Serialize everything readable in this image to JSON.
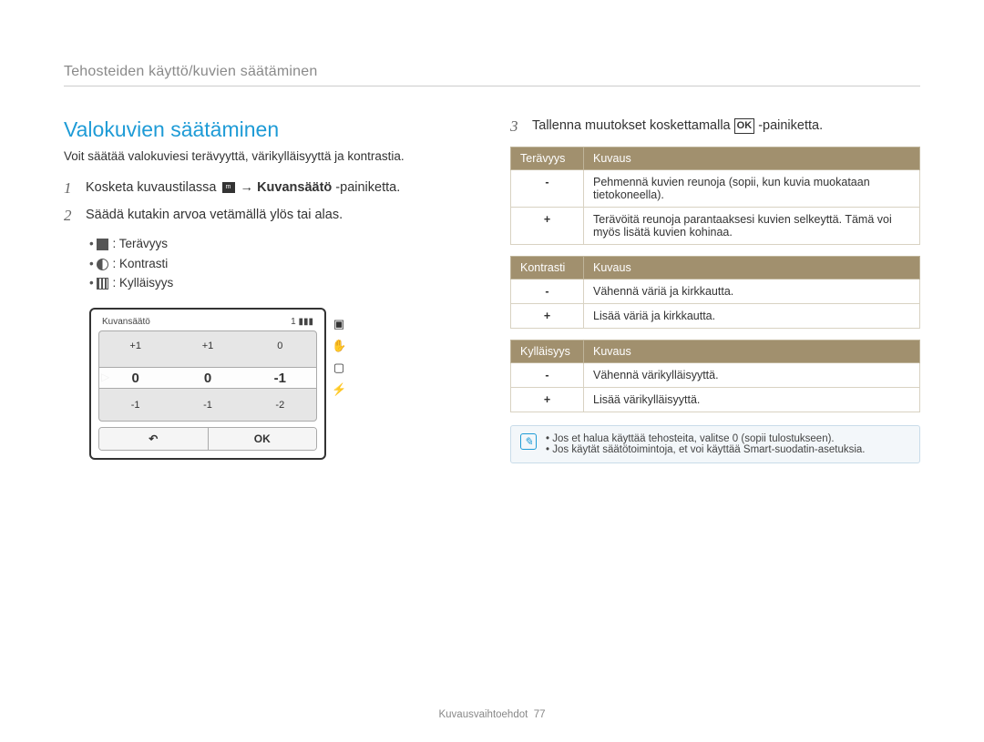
{
  "header": {
    "breadcrumb": "Tehosteiden käyttö/kuvien säätäminen"
  },
  "sectionTitle": "Valokuvien säätäminen",
  "intro": "Voit säätää valokuviesi terävyyttä, värikylläisyyttä ja kontrastia.",
  "steps": {
    "s1_prefix": "Kosketa kuvaustilassa ",
    "s1_menu": "m",
    "s1_arrow": " → ",
    "s1_bold": "Kuvansäätö",
    "s1_suffix": "-painiketta.",
    "s2": "Säädä kutakin arvoa vetämällä ylös tai alas.",
    "s3_prefix": "Tallenna muutokset koskettamalla ",
    "s3_icon": "OK",
    "s3_suffix": "-painiketta."
  },
  "bullets": {
    "b1": "Terävyys",
    "b2": "Kontrasti",
    "b3": "Kylläisyys"
  },
  "device": {
    "title": "Kuvansäätö",
    "counter": "1",
    "rowTop": {
      "c1": "+1",
      "c2": "+1",
      "c3": "0"
    },
    "rowMid": {
      "c1": "0",
      "c2": "0",
      "c3": "-1"
    },
    "rowBot": {
      "c1": "-1",
      "c2": "-1",
      "c3": "-2"
    },
    "back": "↶",
    "ok": "OK"
  },
  "tables": {
    "t1": {
      "h1": "Terävyys",
      "h2": "Kuvaus",
      "r1": {
        "k": "-",
        "v": "Pehmennä kuvien reunoja (sopii, kun kuvia muokataan tietokoneella)."
      },
      "r2": {
        "k": "+",
        "v": "Terävöitä reunoja parantaaksesi kuvien selkeyttä. Tämä voi myös lisätä kuvien kohinaa."
      }
    },
    "t2": {
      "h1": "Kontrasti",
      "h2": "Kuvaus",
      "r1": {
        "k": "-",
        "v": "Vähennä väriä ja kirkkautta."
      },
      "r2": {
        "k": "+",
        "v": "Lisää väriä ja kirkkautta."
      }
    },
    "t3": {
      "h1": "Kylläisyys",
      "h2": "Kuvaus",
      "r1": {
        "k": "-",
        "v": "Vähennä värikylläisyyttä."
      },
      "r2": {
        "k": "+",
        "v": "Lisää värikylläisyyttä."
      }
    }
  },
  "notes": {
    "n1": "Jos et halua käyttää tehosteita, valitse 0 (sopii tulostukseen).",
    "n2": "Jos käytät säätötoimintoja, et voi käyttää Smart-suodatin-asetuksia."
  },
  "footer": {
    "section": "Kuvausvaihtoehdot",
    "page": "77"
  }
}
